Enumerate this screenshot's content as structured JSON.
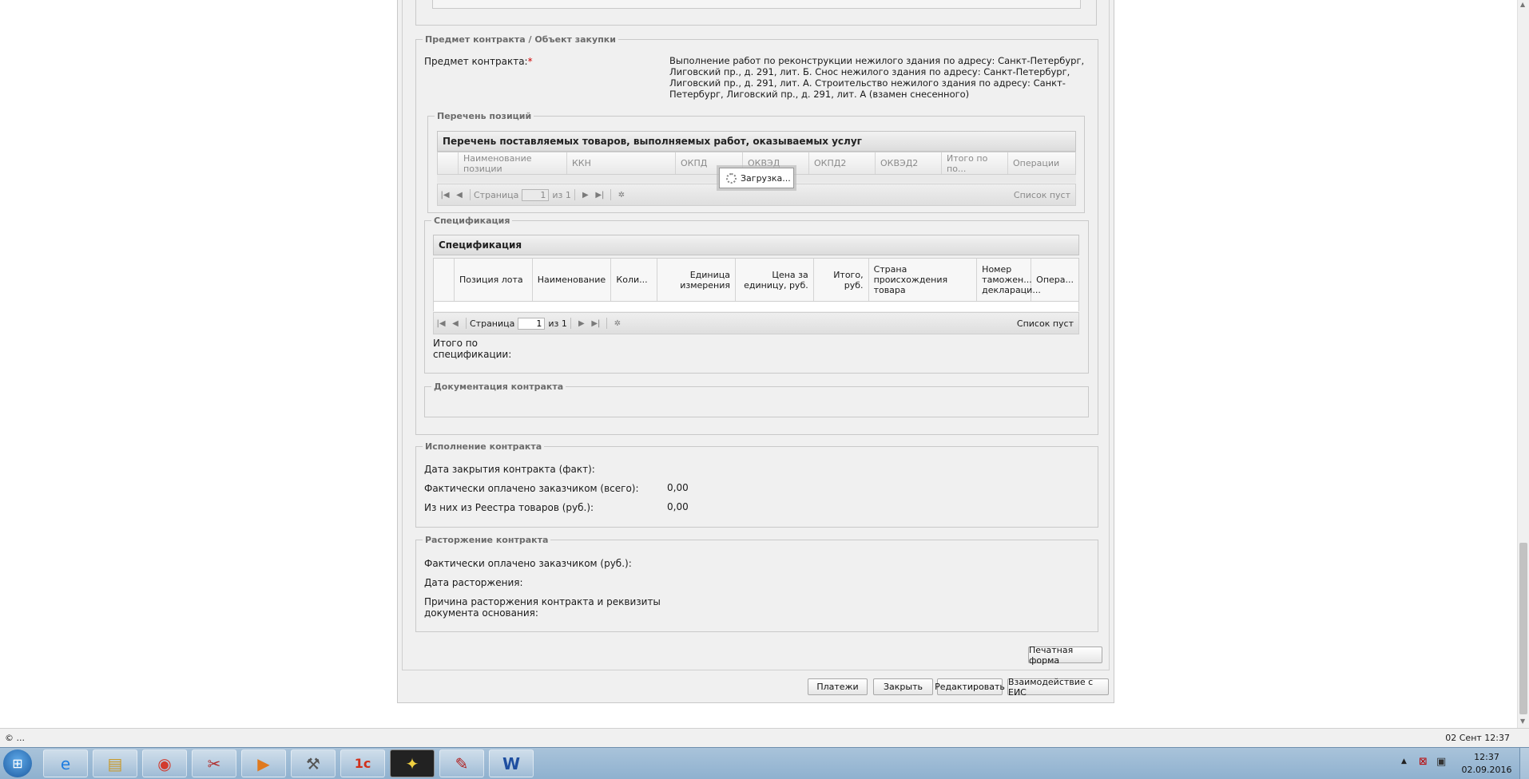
{
  "subject_section": {
    "legend": "Предмет контракта / Объект закупки",
    "subject_label": "Предмет контракта:",
    "required_mark": "*",
    "subject_lines": [
      "Выполнение работ по реконструкции нежилого здания по адресу: Санкт-Петербург,",
      "Лиговский пр., д. 291, лит. Б. Снос нежилого здания по адресу: Санкт-Петербург,",
      "Лиговский пр., д. 291, лит. А. Строительство нежилого здания по адресу: Санкт-",
      "Петербург, Лиговский пр., д. 291, лит. А (взамен снесенного)"
    ]
  },
  "positions": {
    "legend": "Перечень позиций",
    "grid_title": "Перечень поставляемых товаров, выполняемых работ, оказываемых услуг",
    "columns": [
      "Наименование позиции",
      "ККН",
      "ОКПД",
      "ОКВЭД",
      "ОКПД2",
      "ОКВЭД2",
      "Итого по по...",
      "Операции"
    ],
    "page_label": "Страница",
    "page_value": "1",
    "of_label": "из 1",
    "empty_label": "Список пуст",
    "loading_text": "Загрузка..."
  },
  "specification": {
    "legend": "Спецификация",
    "grid_title": "Спецификация",
    "columns": [
      "Позиция лота",
      "Наименование",
      "Коли...",
      "Единица измерения",
      "Цена за единицу, руб.",
      "Итого, руб.",
      "Страна происхождения товара",
      "Номер таможен... деклараци...",
      "Опера..."
    ],
    "page_label": "Страница",
    "page_value": "1",
    "of_label": "из 1",
    "empty_label": "Список пуст",
    "total_label_line1": "Итого по",
    "total_label_line2": "спецификации:"
  },
  "documentation": {
    "legend": "Документация контракта"
  },
  "execution": {
    "legend": "Исполнение контракта",
    "close_date_label": "Дата закрытия контракта (факт):",
    "paid_total_label": "Фактически оплачено заказчиком (всего):",
    "paid_total_value": "0,00",
    "registry_label": "Из них из Реестра товаров (руб.):",
    "registry_value": "0,00"
  },
  "termination": {
    "legend": "Расторжение контракта",
    "paid_label": "Фактически оплачено заказчиком (руб.):",
    "date_label": "Дата расторжения:",
    "reason_line1": "Причина расторжения контракта и реквизиты",
    "reason_line2": "документа основания:"
  },
  "buttons": {
    "print_form": "Печатная форма",
    "payments": "Платежи",
    "close": "Закрыть",
    "edit": "Редактировать",
    "eis": "Взаимодействие с ЕИС"
  },
  "statusbar": {
    "left": "© ...",
    "right": "02 Сент 12:37"
  },
  "taskbar": {
    "apps": [
      "internet-explorer-icon",
      "file-explorer-icon",
      "chrome-icon",
      "snipping-tool-icon",
      "media-player-icon",
      "tools-icon",
      "1c-icon",
      "bat-mail-icon",
      "acrobat-icon",
      "word-icon"
    ],
    "clock_time": "12:37",
    "clock_date": "02.09.2016"
  }
}
